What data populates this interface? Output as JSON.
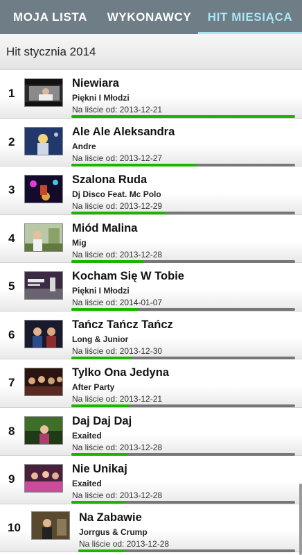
{
  "tabs": [
    "MOJA LISTA",
    "WYKONAWCY",
    "HIT MIESIĄCA"
  ],
  "section_title": "Hit stycznia 2014",
  "colors": {
    "tabbar": "#6f7d87",
    "active_tab": "#a9e7f3",
    "progress": "#1db400"
  },
  "items": [
    {
      "rank": "1",
      "title": "Niewiara",
      "artist": "Piękni I Młodzi",
      "since": "Na liście od: 2013-12-21",
      "progress": 1.0
    },
    {
      "rank": "2",
      "title": "Ale Ale Aleksandra",
      "artist": "Andre",
      "since": "Na liście od: 2013-12-27",
      "progress": 0.56
    },
    {
      "rank": "3",
      "title": "Szalona Ruda",
      "artist": "Dj Disco Feat. Mc Polo",
      "since": "Na liście od: 2013-12-29",
      "progress": 0.42
    },
    {
      "rank": "4",
      "title": "Miód Malina",
      "artist": "Mig",
      "since": "Na liście od: 2013-12-28",
      "progress": 0.32
    },
    {
      "rank": "5",
      "title": "Kocham Się W Tobie",
      "artist": "Piękni I Młodzi",
      "since": "Na liście od: 2014-01-07",
      "progress": 0.3
    },
    {
      "rank": "6",
      "title": "Tańcz Tańcz Tańcz",
      "artist": "Long & Junior",
      "since": "Na liście od: 2013-12-30",
      "progress": 0.27
    },
    {
      "rank": "7",
      "title": "Tylko Ona Jedyna",
      "artist": "After Party",
      "since": "Na liście od: 2013-12-21",
      "progress": 0.26
    },
    {
      "rank": "8",
      "title": "Daj Daj Daj",
      "artist": "Exaited",
      "since": "Na liście od: 2013-12-28",
      "progress": 0.25
    },
    {
      "rank": "9",
      "title": "Nie Unikaj",
      "artist": "Exaited",
      "since": "Na liście od: 2013-12-28",
      "progress": 0.24
    },
    {
      "rank": "10",
      "title": "Na Zabawie",
      "artist": "Jorrgus & Crump",
      "since": "Na liście od: 2013-12-28",
      "progress": 0.21
    }
  ]
}
